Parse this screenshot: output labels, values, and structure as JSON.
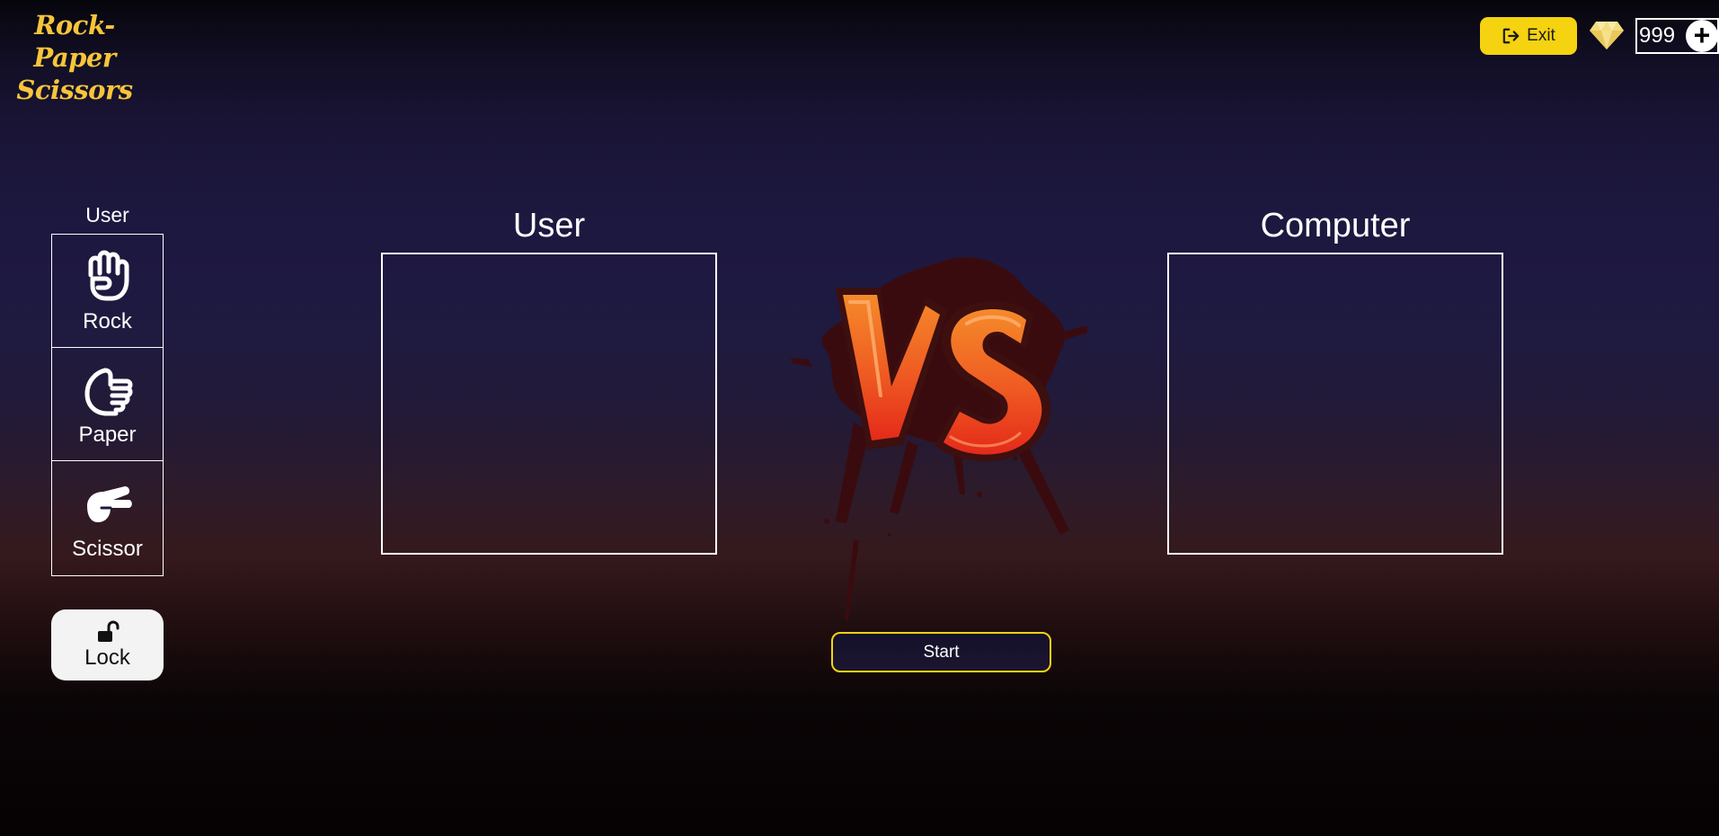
{
  "logo": {
    "line1": "Rock-Paper",
    "line2": "Scissors"
  },
  "topbar": {
    "exit_label": "Exit",
    "exit_icon": "sign-out-icon",
    "gem_icon": "diamond-icon",
    "gem_count": "999",
    "add_label": "+"
  },
  "choice_panel": {
    "label": "User",
    "choices": [
      {
        "label": "Rock",
        "icon": "fist-icon"
      },
      {
        "label": "Paper",
        "icon": "open-hand-icon"
      },
      {
        "label": "Scissor",
        "icon": "two-fingers-icon"
      }
    ],
    "lock_label": "Lock",
    "lock_icon": "unlock-icon"
  },
  "arena": {
    "user_title": "User",
    "computer_title": "Computer",
    "vs_label": "VS",
    "start_label": "Start"
  },
  "colors": {
    "accent_yellow": "#f5d310",
    "logo_yellow": "#f7c53a",
    "vs_orange": "#f0752a",
    "vs_red": "#e8321c"
  }
}
